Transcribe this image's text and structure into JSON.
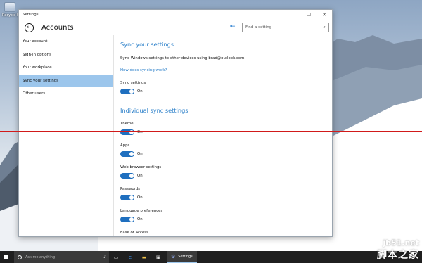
{
  "desktop": {
    "icon_label": "Recycle Bin"
  },
  "window": {
    "title": "Settings",
    "controls": {
      "minimize": "—",
      "maximize": "☐",
      "close": "✕"
    }
  },
  "header": {
    "back_glyph": "←",
    "title": "Accounts",
    "pin_glyph": "⇤",
    "search_placeholder": "Find a setting",
    "search_icon": "search-icon"
  },
  "sidebar": {
    "items": [
      {
        "label": "Your account"
      },
      {
        "label": "Sign-in options"
      },
      {
        "label": "Your workplace"
      },
      {
        "label": "Sync your settings",
        "active": true
      },
      {
        "label": "Other users"
      }
    ]
  },
  "content": {
    "section1_title": "Sync your settings",
    "description": "Sync Windows settings to other devices using brad@outlook.com.",
    "link": "How does syncing work?",
    "sync_label": "Sync settings",
    "sync_state": "On",
    "section2_title": "Individual sync settings",
    "settings": [
      {
        "label": "Theme",
        "state": "On"
      },
      {
        "label": "Apps",
        "state": "On"
      },
      {
        "label": "Web browser settings",
        "state": "On"
      },
      {
        "label": "Passwords",
        "state": "On"
      },
      {
        "label": "Language preferences",
        "state": "On"
      },
      {
        "label": "Ease of Access"
      }
    ]
  },
  "taskbar": {
    "search_placeholder": "Ask me anything",
    "mic_glyph": "🎤",
    "app_label": "Settings"
  },
  "watermark": {
    "line1": "jb51.net",
    "line2": "脚本之家"
  },
  "colors": {
    "accent": "#2a7fc9",
    "toggle_on": "#1f6fbf",
    "active_nav": "#9cc6ec",
    "red_line": "#d11a1a",
    "taskbar": "#1f1f1f"
  }
}
